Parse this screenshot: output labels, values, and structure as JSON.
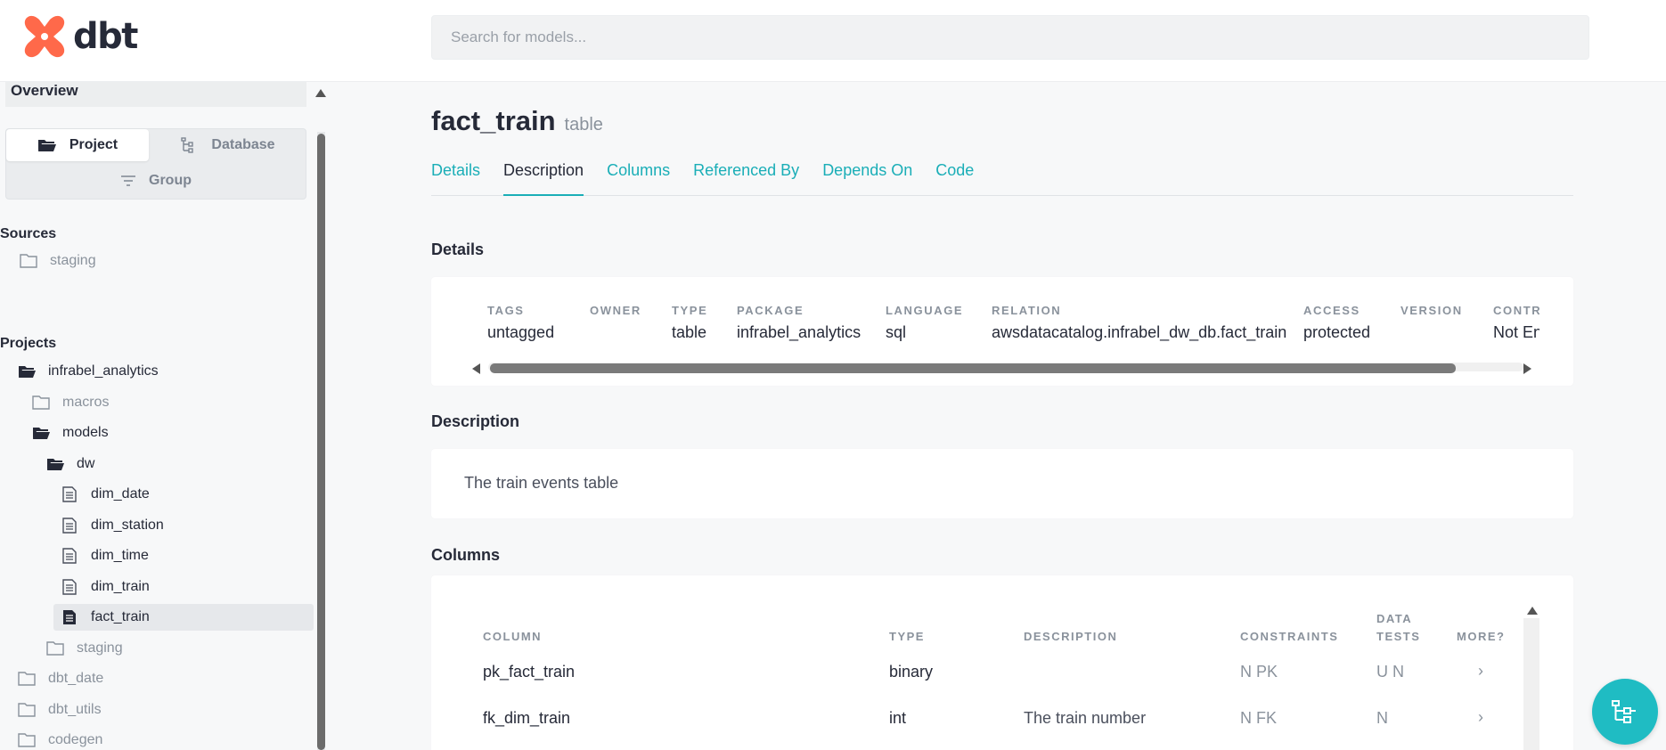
{
  "header": {
    "logo_text": "dbt",
    "search_placeholder": "Search for models..."
  },
  "sidebar": {
    "overview": "Overview",
    "tabs": {
      "project": "Project",
      "database": "Database",
      "group": "Group"
    },
    "sources_label": "Sources",
    "sources": [
      "staging"
    ],
    "projects_label": "Projects",
    "tree": [
      {
        "label": "infrabel_analytics",
        "icon": "folder-open-icon",
        "muted": false
      },
      {
        "label": "macros",
        "icon": "folder-icon",
        "muted": true
      },
      {
        "label": "models",
        "icon": "folder-open-icon",
        "muted": false
      },
      {
        "label": "dw",
        "icon": "folder-open-icon",
        "muted": false
      },
      {
        "label": "dim_date",
        "icon": "file-icon",
        "muted": false
      },
      {
        "label": "dim_station",
        "icon": "file-icon",
        "muted": false
      },
      {
        "label": "dim_time",
        "icon": "file-icon",
        "muted": false
      },
      {
        "label": "dim_train",
        "icon": "file-icon",
        "muted": false
      },
      {
        "label": "fact_train",
        "icon": "file-filled-icon",
        "muted": false,
        "selected": true
      },
      {
        "label": "staging",
        "icon": "folder-icon",
        "muted": true
      },
      {
        "label": "dbt_date",
        "icon": "folder-icon",
        "muted": true
      },
      {
        "label": "dbt_utils",
        "icon": "folder-icon",
        "muted": true
      },
      {
        "label": "codegen",
        "icon": "folder-icon",
        "muted": true
      }
    ]
  },
  "main": {
    "title": "fact_train",
    "title_type": "table",
    "tabs": [
      "Details",
      "Description",
      "Columns",
      "Referenced By",
      "Depends On",
      "Code"
    ],
    "active_tab": "Description",
    "details_heading": "Details",
    "details": [
      {
        "label": "TAGS",
        "value": "untagged"
      },
      {
        "label": "OWNER",
        "value": ""
      },
      {
        "label": "TYPE",
        "value": "table"
      },
      {
        "label": "PACKAGE",
        "value": "infrabel_analytics"
      },
      {
        "label": "LANGUAGE",
        "value": "sql"
      },
      {
        "label": "RELATION",
        "value": "awsdatacatalog.infrabel_dw_db.fact_train"
      },
      {
        "label": "ACCESS",
        "value": "protected"
      },
      {
        "label": "VERSION",
        "value": ""
      },
      {
        "label": "CONTR",
        "value": "Not En"
      }
    ],
    "description_heading": "Description",
    "description_text": "The train events table",
    "columns_heading": "Columns",
    "columns_headers": {
      "column": "COLUMN",
      "type": "TYPE",
      "description": "DESCRIPTION",
      "constraints": "CONSTRAINTS",
      "data_tests_1": "DATA",
      "data_tests_2": "TESTS",
      "more": "MORE?"
    },
    "columns_rows": [
      {
        "column": "pk_fact_train",
        "type": "binary",
        "description": "",
        "constraints": "N PK",
        "tests": "U N",
        "more": "›"
      },
      {
        "column": "fk_dim_train",
        "type": "int",
        "description": "The train number",
        "constraints": "N FK",
        "tests": "N",
        "more": "›"
      }
    ]
  },
  "colors": {
    "accent": "#1aaeb7",
    "fab": "#1fbcc3",
    "logo": "#ff694a"
  }
}
